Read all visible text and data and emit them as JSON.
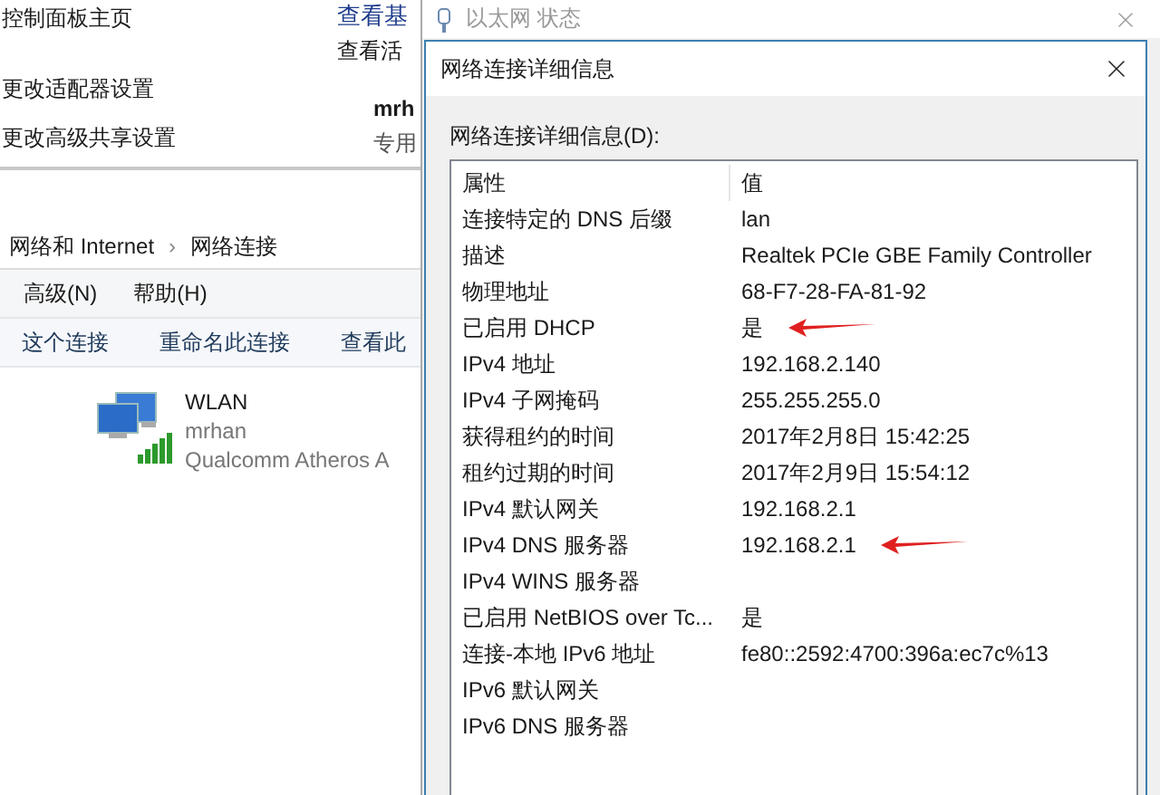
{
  "control_panel": {
    "sidebar_links": [
      "控制面板主页",
      "更改适配器设置",
      "更改高级共享设置"
    ],
    "heading": "查看基",
    "subheading": "查看活",
    "network_name": "mrh",
    "network_type": "专用"
  },
  "explorer": {
    "breadcrumb": [
      "网络和 Internet",
      "网络连接"
    ],
    "breadcrumb_separator": "›",
    "menu": [
      "高级(N)",
      "帮助(H)"
    ],
    "toolbar": [
      "这个连接",
      "重命名此连接",
      "查看此"
    ],
    "connections": [
      {
        "name": "WLAN",
        "network": "mrhan",
        "adapter": "Qualcomm Atheros A"
      }
    ]
  },
  "status_window": {
    "title": "以太网 状态"
  },
  "details_dialog": {
    "title": "网络连接详细信息",
    "label": "网络连接详细信息(D):",
    "columns": [
      "属性",
      "值"
    ],
    "rows": [
      {
        "property": "连接特定的 DNS 后缀",
        "value": "lan",
        "marked": false
      },
      {
        "property": "描述",
        "value": "Realtek PCIe GBE Family Controller",
        "marked": false
      },
      {
        "property": "物理地址",
        "value": "68-F7-28-FA-81-92",
        "marked": false
      },
      {
        "property": "已启用 DHCP",
        "value": "是",
        "marked": true
      },
      {
        "property": "IPv4 地址",
        "value": "192.168.2.140",
        "marked": false
      },
      {
        "property": "IPv4 子网掩码",
        "value": "255.255.255.0",
        "marked": false
      },
      {
        "property": "获得租约的时间",
        "value": "2017年2月8日 15:42:25",
        "marked": false
      },
      {
        "property": "租约过期的时间",
        "value": "2017年2月9日 15:54:12",
        "marked": false
      },
      {
        "property": "IPv4 默认网关",
        "value": "192.168.2.1",
        "marked": false
      },
      {
        "property": "IPv4 DNS 服务器",
        "value": "192.168.2.1",
        "marked": true
      },
      {
        "property": "IPv4 WINS 服务器",
        "marked": false
      },
      {
        "property": "已启用 NetBIOS over Tc...",
        "value": "是",
        "marked": false
      },
      {
        "property": "连接-本地 IPv6 地址",
        "value": "fe80::2592:4700:396a:ec7c%13",
        "marked": false
      },
      {
        "property": "IPv6 默认网关",
        "marked": false
      },
      {
        "property": "IPv6 DNS 服务器",
        "marked": false
      }
    ]
  }
}
